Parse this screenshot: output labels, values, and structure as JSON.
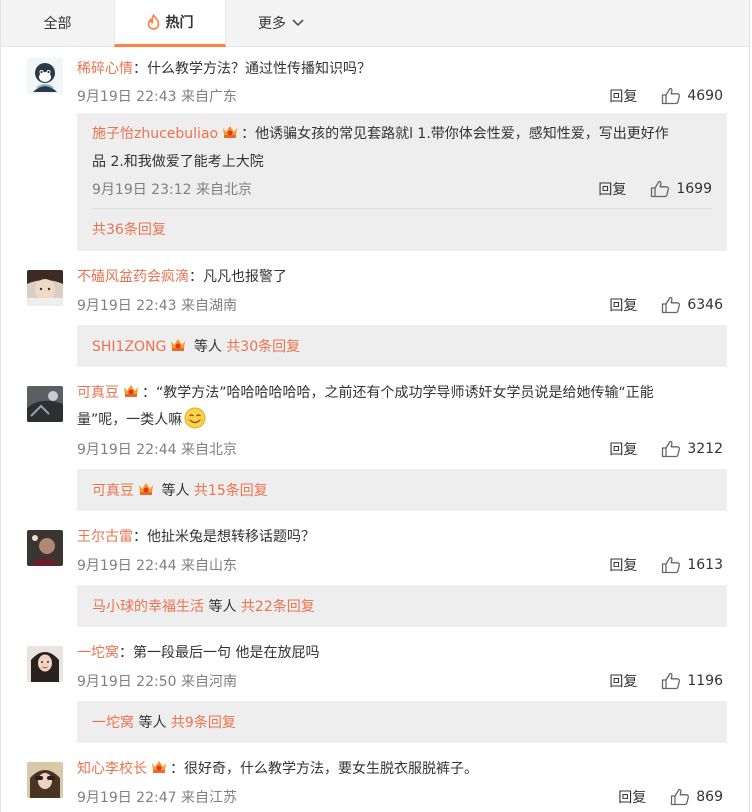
{
  "tabs": {
    "all": "全部",
    "hot": "热门",
    "more": "更多"
  },
  "colors": {
    "accent": "#ff8140",
    "username": "#eb7350",
    "meta": "#808080",
    "box_bg": "#eeeeee"
  },
  "reply_label": "回复",
  "comments": [
    {
      "user": "稀碎心情",
      "text": "：什么教学方法？通过性传播知识吗？",
      "time": "9月19日 22:43 来自广东",
      "likes": "4690",
      "sub": {
        "user": "施子怡zhucebuliao",
        "text_line1": "：他诱骗女孩的常见套路就l 1.带你体会性爱，感知性爱，写出更好作",
        "text_line2": "品 2.和我做爱了能考上大院",
        "time": "9月19日 23:12 来自北京",
        "likes": "1699"
      },
      "reply_total": "共36条回复"
    },
    {
      "user": "不磕风盆药会疯滴",
      "text": "：凡凡也报警了",
      "time": "9月19日 22:43 来自湖南",
      "likes": "6346",
      "reply_user": "SHI1ZONG",
      "reply_mid": "等人",
      "reply_total": "共30条回复"
    },
    {
      "user": "可真豆",
      "text_line1": "：“教学方法”哈哈哈哈哈哈，之前还有个成功学导师诱奸女学员说是给她传输“正能",
      "text_line2": "量”呢，一类人嘛",
      "time": "9月19日 22:44 来自北京",
      "likes": "3212",
      "reply_user": "可真豆",
      "reply_mid": "等人",
      "reply_total": "共15条回复"
    },
    {
      "user": "王尔古雷",
      "text": "：他扯米兔是想转移话题吗？",
      "time": "9月19日 22:44 来自山东",
      "likes": "1613",
      "reply_user": "马小球的幸福生活",
      "reply_mid": "等人",
      "reply_total": "共22条回复"
    },
    {
      "user": "一坨窝",
      "text": "：第一段最后一句 他是在放屁吗",
      "time": "9月19日 22:50 来自河南",
      "likes": "1196",
      "reply_user": "一坨窝",
      "reply_mid": "等人",
      "reply_total": "共9条回复"
    },
    {
      "user": "知心李校长",
      "text": "：很好奇，什么教学方法，要女生脱衣服脱裤子。",
      "time": "9月19日 22:47 来自江苏",
      "likes": "869"
    }
  ]
}
